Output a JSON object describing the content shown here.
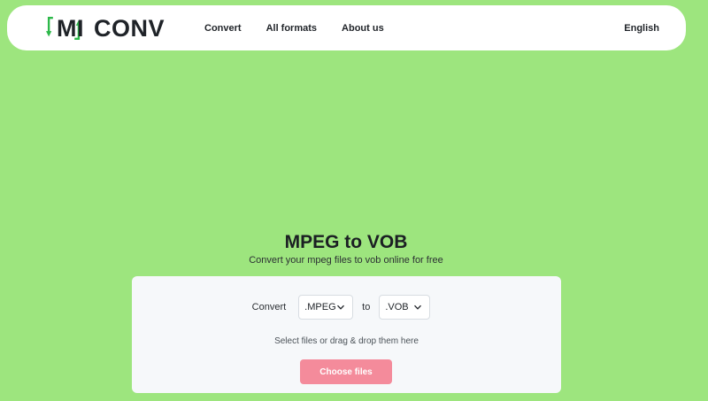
{
  "header": {
    "logo_mi": "MI",
    "logo_conv": "CONV",
    "nav": [
      "Convert",
      "All formats",
      "About us"
    ],
    "language": "English"
  },
  "hero": {
    "title": "MPEG to VOB",
    "subtitle": "Convert your mpeg files to vob online for free"
  },
  "converter": {
    "convert_label": "Convert",
    "from_format": ".MPEG",
    "to_label": "to",
    "to_format": ".VOB",
    "hint": "Select files or drag & drop them here",
    "button_label": "Choose files"
  },
  "colors": {
    "background": "#9de57e",
    "logo_green": "#2db84a",
    "button": "#f48b9b"
  },
  "icons": {
    "logo": "conversion-arrows-icon",
    "dropdown": "chevron-down-icon"
  }
}
